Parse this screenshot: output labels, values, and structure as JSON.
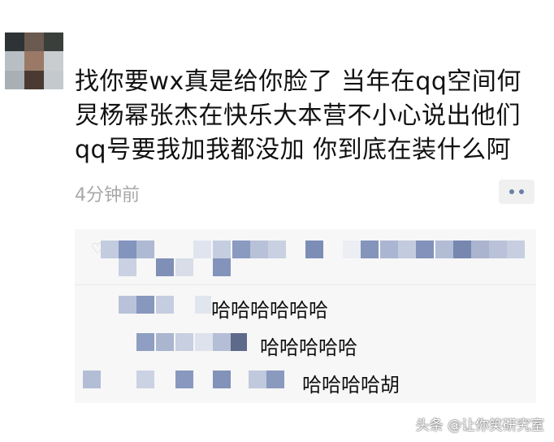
{
  "post": {
    "lines": [
      "找你要wx真是给你脸了 当年在qq空间何",
      "炅杨幂张杰在快乐大本营不小心说出他们",
      "qq号要我加我都没加 你到底在装什么阿"
    ],
    "timestamp": "4分钟前"
  },
  "comments": [
    {
      "text": "哈哈哈哈哈哈"
    },
    {
      "text": "哈哈哈哈哈"
    },
    {
      "text": "哈哈哈哈胡"
    }
  ],
  "watermark": "头条 @让你笑研究室",
  "icons": {
    "more": "ellipsis-icon",
    "like": "heart-icon"
  },
  "colors": {
    "timestamp": "#a8a8a8",
    "blur_blue": "#7b8fb8",
    "panel_bg": "#f7f7f7"
  }
}
